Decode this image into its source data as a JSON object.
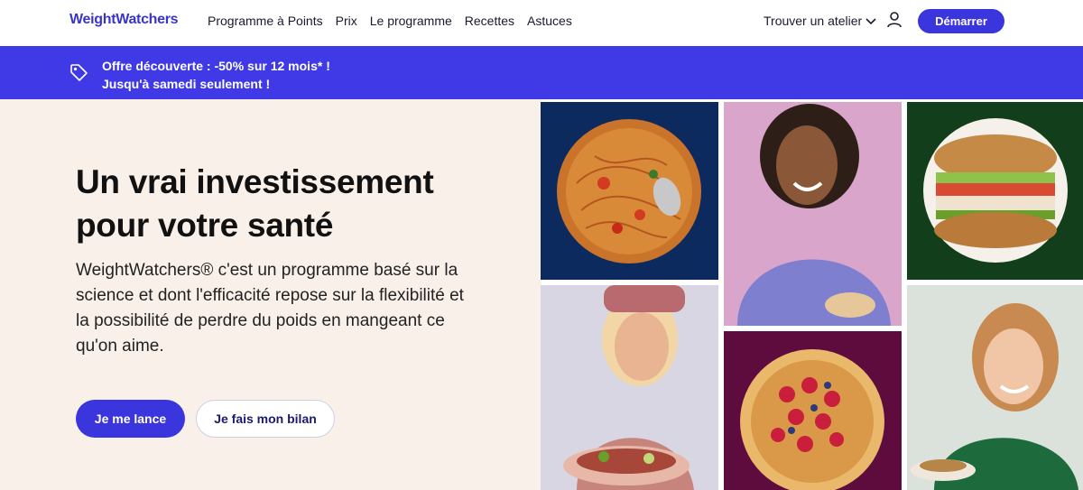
{
  "header": {
    "logo": "WeightWatchers",
    "nav": [
      "Programme à Points",
      "Prix",
      "Le programme",
      "Recettes",
      "Astuces"
    ],
    "find_label": "Trouver un atelier",
    "cta_label": "Démarrer"
  },
  "promo": {
    "line1": "Offre découverte : -50% sur 12 mois* !",
    "line2": "Jusqu'à samedi seulement !"
  },
  "hero": {
    "title": "Un vrai investissement pour votre santé",
    "body": "WeightWatchers® c'est un programme basé sur la science et dont l'efficacité repose sur la flexibilité et la possibilité de perdre du poids en mangeant ce qu'on aime.",
    "primary_label": "Je me lance",
    "secondary_label": "Je fais mon bilan"
  },
  "colors": {
    "brand": "#3a35dd",
    "promo_bg": "#3f3ae6",
    "hero_bg": "#f9f0ea"
  },
  "images": [
    {
      "name": "spaghetti-photo"
    },
    {
      "name": "woman-smiling-photo"
    },
    {
      "name": "sandwich-photo"
    },
    {
      "name": "woman-tacos-photo"
    },
    {
      "name": "pancakes-photo"
    },
    {
      "name": "woman-pasta-photo"
    }
  ]
}
